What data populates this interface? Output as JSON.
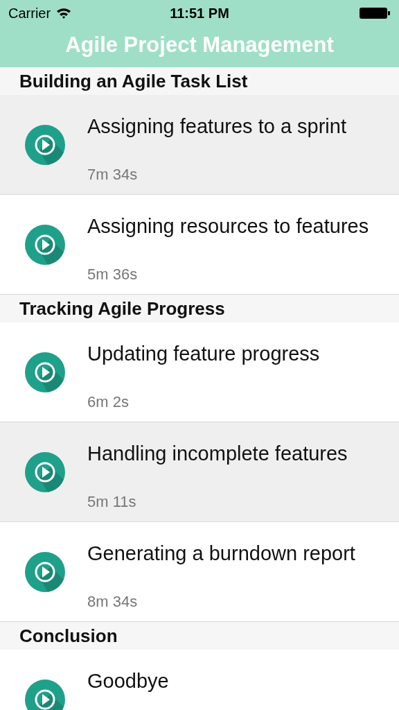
{
  "status_bar": {
    "carrier": "Carrier",
    "time": "11:51 PM"
  },
  "nav": {
    "title": "Agile Project Management"
  },
  "sections": [
    {
      "title": "Building an Agile Task List",
      "items": [
        {
          "title": "Assigning features to a sprint",
          "duration": "7m 34s",
          "selected": true
        },
        {
          "title": "Assigning resources to features",
          "duration": "5m 36s",
          "selected": false
        }
      ]
    },
    {
      "title": "Tracking Agile Progress",
      "items": [
        {
          "title": "Updating feature progress",
          "duration": "6m 2s",
          "selected": false
        },
        {
          "title": "Handling incomplete features",
          "duration": "5m 11s",
          "selected": true
        },
        {
          "title": "Generating a burndown report",
          "duration": "8m 34s",
          "selected": false
        }
      ]
    },
    {
      "title": "Conclusion",
      "items": [
        {
          "title": "Goodbye",
          "selected": false
        }
      ]
    }
  ]
}
